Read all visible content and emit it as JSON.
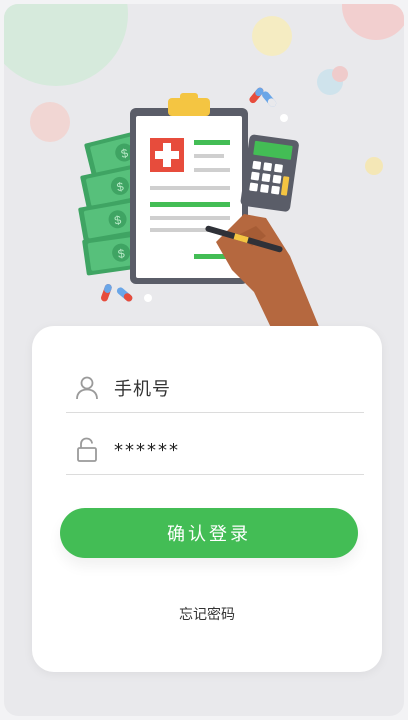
{
  "login": {
    "phone_label": "手机号",
    "password_value": "******",
    "submit_label": "确认登录",
    "forgot_label": "忘记密码"
  },
  "colors": {
    "accent": "#43bd55",
    "background": "#e9e9ec",
    "card": "#ffffff"
  },
  "icons": {
    "phone_field": "user-icon",
    "password_field": "unlock-icon"
  }
}
